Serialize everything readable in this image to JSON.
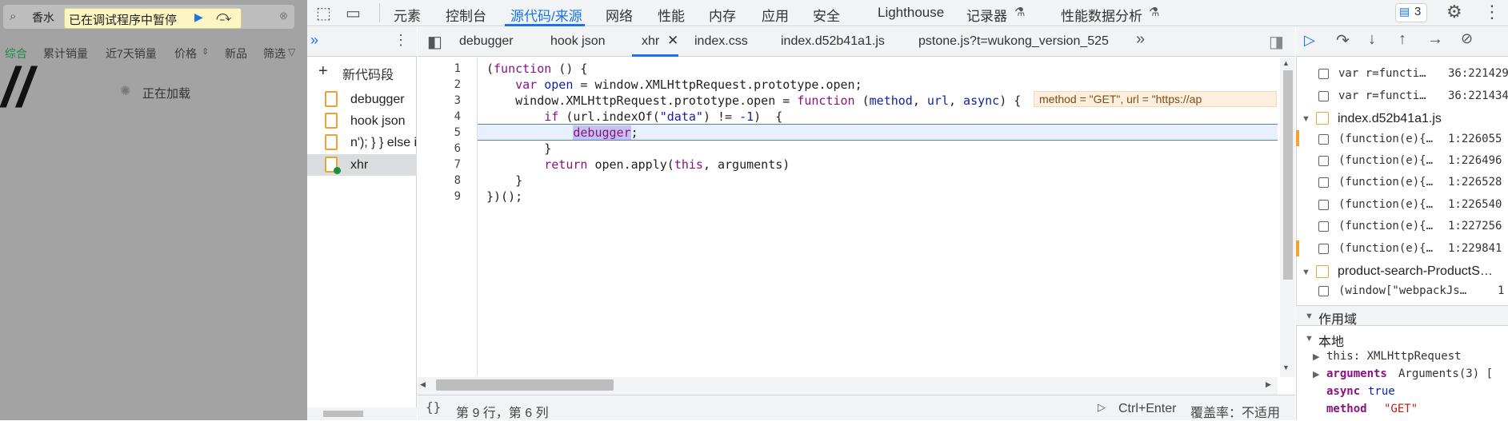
{
  "page": {
    "search_value": "香水",
    "paused_banner": "已在调试程序中暂停",
    "tabs": [
      "综合",
      "累计销量",
      "近7天销量",
      "价格",
      "新品",
      "筛选"
    ],
    "loading": "正在加载",
    "slashes": "//"
  },
  "devtools": {
    "top_tabs": [
      "元素",
      "控制台",
      "源代码/来源",
      "网络",
      "性能",
      "内存",
      "应用",
      "安全",
      "Lighthouse",
      "记录器",
      "性能数据分析"
    ],
    "issues_count": "3",
    "file_tabs": [
      "debugger",
      "hook json",
      "xhr",
      "index.css",
      "index.d52b41a1.js",
      "pstone.js?t=wukong_version_525"
    ],
    "navigator": {
      "new_snippet": "新代码段",
      "files": [
        "debugger",
        "hook json",
        "n'); } } else i",
        "xhr"
      ]
    },
    "editor": {
      "line_numbers": [
        "1",
        "2",
        "3",
        "4",
        "5",
        "6",
        "7",
        "8",
        "9"
      ],
      "inline_values": "method = \"GET\", url = \"https://ap"
    },
    "footer": {
      "position": "第 9 行，第 6 列",
      "shortcut": "Ctrl+Enter",
      "coverage": "覆盖率：不适用"
    },
    "breakpoints": [
      {
        "code": "var r=functi…",
        "loc": "36:221429"
      },
      {
        "code": "var r=functi…",
        "loc": "36:221434"
      }
    ],
    "bp_file": "index.d52b41a1.js",
    "bp_file_items": [
      {
        "code": "(function(e){…",
        "loc": "1:226055"
      },
      {
        "code": "(function(e){…",
        "loc": "1:226496"
      },
      {
        "code": "(function(e){…",
        "loc": "1:226528"
      },
      {
        "code": "(function(e){…",
        "loc": "1:226540"
      },
      {
        "code": "(function(e){…",
        "loc": "1:227256"
      },
      {
        "code": "(function(e){…",
        "loc": "1:229841"
      }
    ],
    "bp_file2": "product-search-ProductS…",
    "bp_file2_item": {
      "code": "(window[\"webpackJs…",
      "loc": "1"
    },
    "scope": {
      "title": "作用域",
      "local": "本地",
      "this_label": "this: XMLHttpRequest",
      "arguments_label": "arguments",
      "arguments_value": "Arguments(3) [",
      "async_label": "async",
      "async_value": "true",
      "method_label": "method",
      "method_value": "\"GET\""
    }
  }
}
